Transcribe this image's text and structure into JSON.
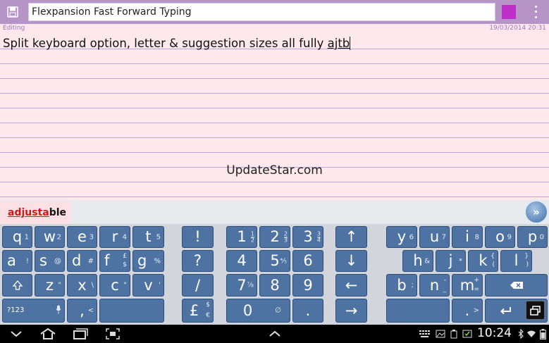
{
  "window": {
    "title": "Flexpansion Fast Forward Typing",
    "accent_color": "#c02ec8",
    "titlebar_color": "#b794c8"
  },
  "note": {
    "status": "Editing",
    "timestamp": "19/03/2014 20:31",
    "text_before": "Split keyboard option, letter & suggestion sizes  all fully ",
    "text_current_word": "ajtb",
    "watermark": "UpdateStar.com"
  },
  "suggestion": {
    "typed_part": "adjusta",
    "completion_part": "ble"
  },
  "keyboard": {
    "left_row1": [
      {
        "m": "q",
        "s": "1"
      },
      {
        "m": "w",
        "s": "2"
      },
      {
        "m": "e",
        "s": "3"
      },
      {
        "m": "r",
        "s": "4"
      },
      {
        "m": "t",
        "s": "5"
      }
    ],
    "left_row2": [
      {
        "m": "a",
        "s": "!"
      },
      {
        "m": "s",
        "s": "@"
      },
      {
        "m": "d",
        "s": "#"
      },
      {
        "m": "f",
        "st": "£",
        "sb": "$"
      },
      {
        "m": "g",
        "s": "%"
      }
    ],
    "left_row3": [
      {
        "m": "z",
        "s": "\""
      },
      {
        "m": "x",
        "s": "\\"
      },
      {
        "m": "c",
        "s": "\""
      },
      {
        "m": "v",
        "s": "'"
      }
    ],
    "left_row4": {
      "symbols_label": "?123",
      "comma": ",",
      "lt": "<"
    },
    "mid_col1": [
      "!",
      "?",
      "/"
    ],
    "mid_col1_bottom": {
      "m": "£",
      "st": "$",
      "sb": "€"
    },
    "numpad": [
      {
        "m": "1",
        "fn": "1",
        "fd": "2"
      },
      {
        "m": "2",
        "fn": "2",
        "fd": "3"
      },
      {
        "m": "3",
        "fn": "3",
        "fd": "4"
      },
      {
        "m": "4",
        "fn": "",
        "fd": ""
      },
      {
        "m": "5",
        "s": "%"
      },
      {
        "m": "6",
        "s": ""
      },
      {
        "m": "7",
        "s": "⅞"
      },
      {
        "m": "8",
        "s": ""
      },
      {
        "m": "9",
        "s": ""
      }
    ],
    "numpad_zero": "0",
    "numpad_zero_alt": "∅",
    "numpad_dot": ".",
    "numpad_dot_alt": ">",
    "arrows": [
      "↑",
      "↓",
      "←",
      "→"
    ],
    "right_row1": [
      {
        "m": "y",
        "s": "6"
      },
      {
        "m": "u",
        "s": "7"
      },
      {
        "m": "i",
        "s": "8"
      },
      {
        "m": "o",
        "s": "9"
      },
      {
        "m": "p",
        "s": "0"
      }
    ],
    "right_row2": [
      {
        "m": "h",
        "s": "&"
      },
      {
        "m": "j",
        "s": "*"
      },
      {
        "m": "k",
        "st": "{",
        "sb": "("
      },
      {
        "m": "l",
        "st": "}",
        "sb": ")"
      }
    ],
    "right_row3": [
      {
        "m": "b",
        "s": ";"
      },
      {
        "m": "n",
        "st": "-",
        "sb": "_"
      },
      {
        "m": "m",
        "st": "+",
        "sb": "="
      }
    ],
    "right_row4": {
      "period": ".",
      "period_alt": ">"
    },
    "four_fifths": "⅘"
  },
  "system": {
    "time": "10:24"
  }
}
